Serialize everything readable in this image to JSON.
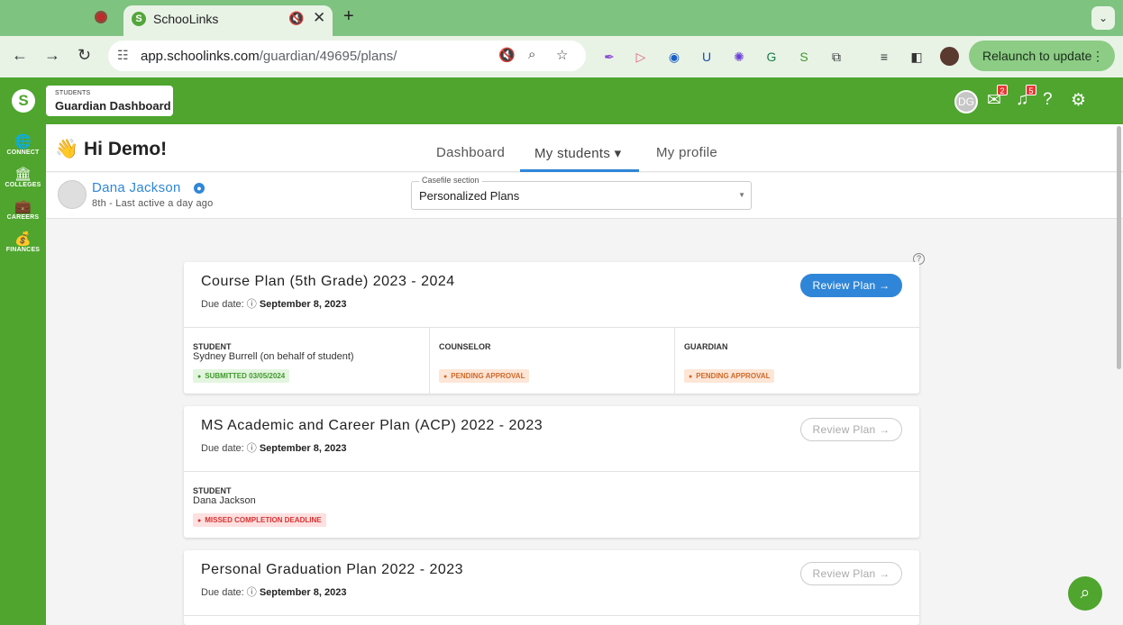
{
  "browser": {
    "tab_title": "SchooLinks",
    "tab_favicon": "S",
    "url_host": "app.schoolinks.com",
    "url_path": "/guardian/49695/plans/",
    "relaunch_label": "Relaunch to update",
    "relaunch_menu": "⋮"
  },
  "header": {
    "dashboard_small": "STUDENTS",
    "dashboard_title": "Guardian Dashboard",
    "avatar_initials": "DG",
    "messages_count": "2",
    "notifications_count": "5"
  },
  "sidebar": {
    "items": [
      {
        "label": "CONNECT",
        "icon": "globe-icon"
      },
      {
        "label": "COLLEGES",
        "icon": "college-icon"
      },
      {
        "label": "CAREERS",
        "icon": "briefcase-icon"
      },
      {
        "label": "FINANCES",
        "icon": "money-bag-icon"
      }
    ]
  },
  "topnav": {
    "greeting_emoji": "👋",
    "greeting": "Hi Demo!",
    "links": [
      "Dashboard",
      "My students ▾",
      "My profile"
    ]
  },
  "student": {
    "name": "Dana Jackson",
    "meta": "8th - Last active a day ago",
    "casefile_label": "Casefile section",
    "casefile_value": "Personalized Plans"
  },
  "plans": [
    {
      "title": "Course Plan (5th Grade) 2023 - 2024",
      "due_label": "Due date:",
      "due_date": "September 8, 2023",
      "button": "Review Plan →",
      "columns": [
        {
          "role": "STUDENT",
          "name": "Sydney Burrell (on behalf of student)",
          "status": "SUBMITTED 03/05/2024"
        },
        {
          "role": "COUNSELOR",
          "name": "",
          "status": "PENDING APPROVAL"
        },
        {
          "role": "GUARDIAN",
          "name": "",
          "status": "PENDING APPROVAL"
        }
      ]
    },
    {
      "title": "MS Academic and Career Plan (ACP) 2022 - 2023",
      "due_label": "Due date:",
      "due_date": "September 8, 2023",
      "button": "Review Plan →",
      "columns": [
        {
          "role": "STUDENT",
          "name": "Dana Jackson",
          "status": "MISSED COMPLETION DEADLINE"
        }
      ]
    },
    {
      "title": "Personal Graduation Plan 2022 - 2023",
      "due_label": "Due date:",
      "due_date": "September 8, 2023",
      "button": "Review Plan →"
    }
  ],
  "colors": {
    "brand_green": "#4fa52e",
    "link_blue": "#2f86d8",
    "status_green": "#3f9a2a",
    "status_orange": "#d0692a",
    "status_red": "#d93030"
  }
}
